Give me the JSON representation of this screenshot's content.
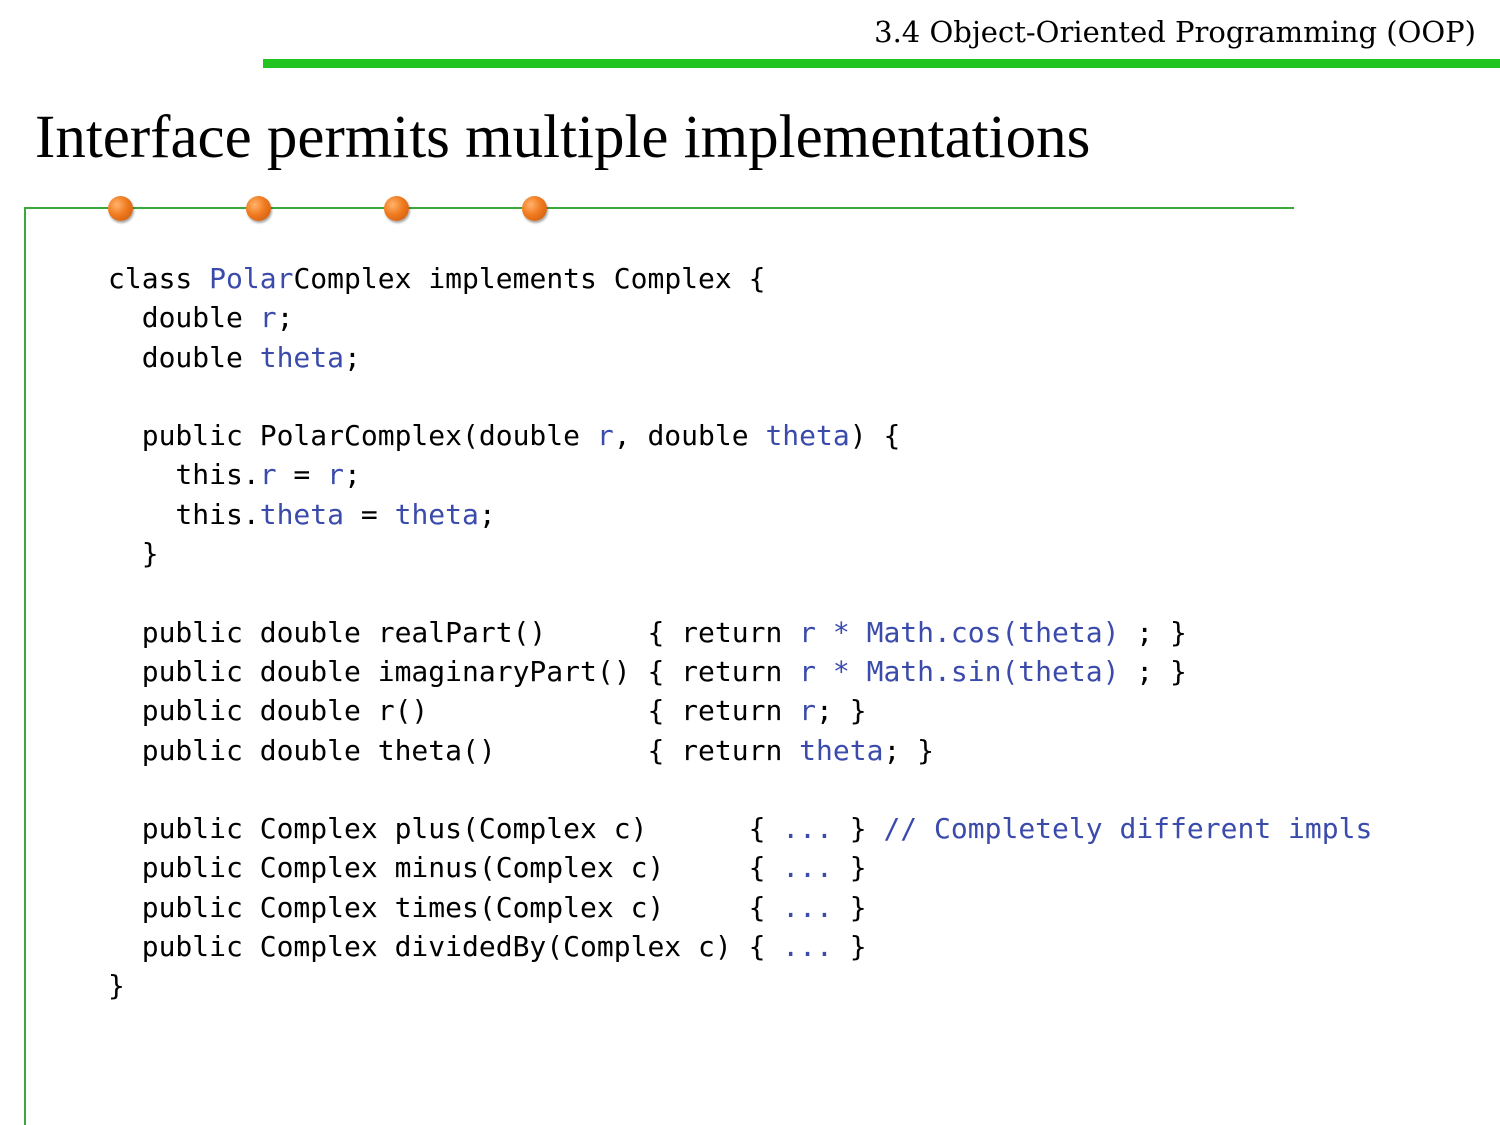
{
  "header": {
    "section_title": "3.4 Object-Oriented Programming (OOP)",
    "slide_title": "Interface permits multiple implementations"
  },
  "colors": {
    "accent_bar": "#22c41f",
    "frame_line": "#3aa83a",
    "dot": "#f07a1f",
    "code_default": "#000000",
    "code_highlight": "#3b4bab"
  },
  "code": {
    "lines": [
      [
        {
          "t": "class ",
          "h": false
        },
        {
          "t": "Polar",
          "h": true
        },
        {
          "t": "Complex implements Complex {",
          "h": false
        }
      ],
      [
        {
          "t": "  double ",
          "h": false
        },
        {
          "t": "r",
          "h": true
        },
        {
          "t": ";",
          "h": false
        }
      ],
      [
        {
          "t": "  double ",
          "h": false
        },
        {
          "t": "theta",
          "h": true
        },
        {
          "t": ";",
          "h": false
        }
      ],
      [],
      [
        {
          "t": "  public PolarComplex(double ",
          "h": false
        },
        {
          "t": "r",
          "h": true
        },
        {
          "t": ", double ",
          "h": false
        },
        {
          "t": "theta",
          "h": true
        },
        {
          "t": ") {",
          "h": false
        }
      ],
      [
        {
          "t": "    this.",
          "h": false
        },
        {
          "t": "r",
          "h": true
        },
        {
          "t": " = ",
          "h": false
        },
        {
          "t": "r",
          "h": true
        },
        {
          "t": ";",
          "h": false
        }
      ],
      [
        {
          "t": "    this.",
          "h": false
        },
        {
          "t": "theta",
          "h": true
        },
        {
          "t": " = ",
          "h": false
        },
        {
          "t": "theta",
          "h": true
        },
        {
          "t": ";",
          "h": false
        }
      ],
      [
        {
          "t": "  }",
          "h": false
        }
      ],
      [],
      [
        {
          "t": "  public double realPart()      { return ",
          "h": false
        },
        {
          "t": "r * Math.cos(theta)",
          "h": true
        },
        {
          "t": " ; }",
          "h": false
        }
      ],
      [
        {
          "t": "  public double imaginaryPart() { return ",
          "h": false
        },
        {
          "t": "r * Math.sin(theta)",
          "h": true
        },
        {
          "t": " ; }",
          "h": false
        }
      ],
      [
        {
          "t": "  public double r()             { return ",
          "h": false
        },
        {
          "t": "r",
          "h": true
        },
        {
          "t": "; }",
          "h": false
        }
      ],
      [
        {
          "t": "  public double theta()         { return ",
          "h": false
        },
        {
          "t": "theta",
          "h": true
        },
        {
          "t": "; }",
          "h": false
        }
      ],
      [],
      [
        {
          "t": "  public Complex plus(Complex c)      { ",
          "h": false
        },
        {
          "t": "...",
          "h": true
        },
        {
          "t": " } ",
          "h": false
        },
        {
          "t": "// Completely different impls",
          "h": true
        }
      ],
      [
        {
          "t": "  public Complex minus(Complex c)     { ",
          "h": false
        },
        {
          "t": "...",
          "h": true
        },
        {
          "t": " }",
          "h": false
        }
      ],
      [
        {
          "t": "  public Complex times(Complex c)     { ",
          "h": false
        },
        {
          "t": "...",
          "h": true
        },
        {
          "t": " }",
          "h": false
        }
      ],
      [
        {
          "t": "  public Complex dividedBy(Complex c) { ",
          "h": false
        },
        {
          "t": "...",
          "h": true
        },
        {
          "t": " }",
          "h": false
        }
      ],
      [
        {
          "t": "}",
          "h": false
        }
      ]
    ]
  }
}
